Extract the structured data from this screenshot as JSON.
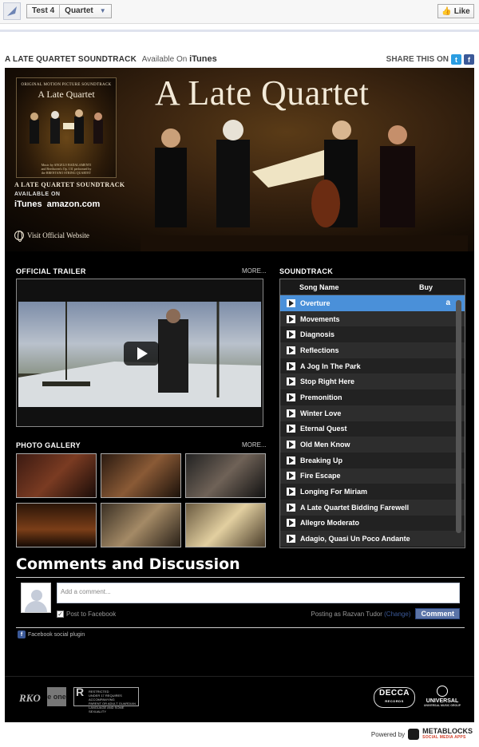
{
  "top_bar": {
    "tab_name": "Test 4",
    "tab_page": "Quartet",
    "like_label": "Like"
  },
  "header": {
    "title": "A LATE QUARTET SOUNDTRACK",
    "available_on": "Available On",
    "store": "iTunes",
    "share_label": "SHARE THIS ON"
  },
  "hero": {
    "title": "A Late Quartet",
    "album_subtitle": "ORIGINAL MOTION PICTURE SOUNDTRACK",
    "album_title": "A Late Quartet",
    "album_footer": "Music by ANGELO BADALAMENTI\nand Beethoven's Op. 131 performed by\nthe BRENTANO STRING QUARTET",
    "soundtrack_label": "A LATE QUARTET SOUNDTRACK",
    "available_label": "AVAILABLE ON",
    "store_itunes": "iTunes",
    "store_amazon": "amazon.com",
    "visit_label": "Visit Official Website"
  },
  "trailer": {
    "heading": "OFFICIAL TRAILER",
    "more": "MORE..."
  },
  "gallery": {
    "heading": "PHOTO GALLERY",
    "more": "MORE..."
  },
  "soundtrack": {
    "heading": "SOUNDTRACK",
    "col_song": "Song Name",
    "col_buy": "Buy",
    "tracks": [
      "Overture",
      "Movements",
      "Diagnosis",
      "Reflections",
      "A Jog In The Park",
      "Stop Right Here",
      "Premonition",
      "Winter Love",
      "Eternal Quest",
      "Old Men Know",
      "Breaking Up",
      "Fire Escape",
      "Longing For Miriam",
      "A Late Quartet Bidding Farewell",
      "Allegro Moderato",
      "Adagio, Quasi Un Poco Andante"
    ]
  },
  "comments": {
    "heading": "Comments and Discussion",
    "placeholder": "Add a comment...",
    "post_to_facebook": "Post to Facebook",
    "posting_as": "Posting as Razvan Tudor",
    "change": "(Change)",
    "button": "Comment",
    "plugin_label": "Facebook social plugin"
  },
  "footer": {
    "rko": "RKO",
    "eone": "e one",
    "rating_text": "RESTRICTED\nUNDER 17 REQUIRES ACCOMPANYING\nPARENT OR ADULT GUARDIAN\nLANGUAGE AND SOME SEXUALITY",
    "rating_letter": "R",
    "decca": "DECCA",
    "decca_sub": "RECORDS",
    "universal": "UNIVERSAL",
    "universal_sub": "UNIVERSAL MUSIC GROUP",
    "powered_by": "Powered by",
    "metablocks": "METABLOCKS",
    "metablocks_sub": "SOCIAL MEDIA APPS"
  },
  "colors": {
    "active_track": "#4a90d9",
    "facebook_blue": "#3b5998",
    "twitter_blue": "#2b9de1"
  }
}
